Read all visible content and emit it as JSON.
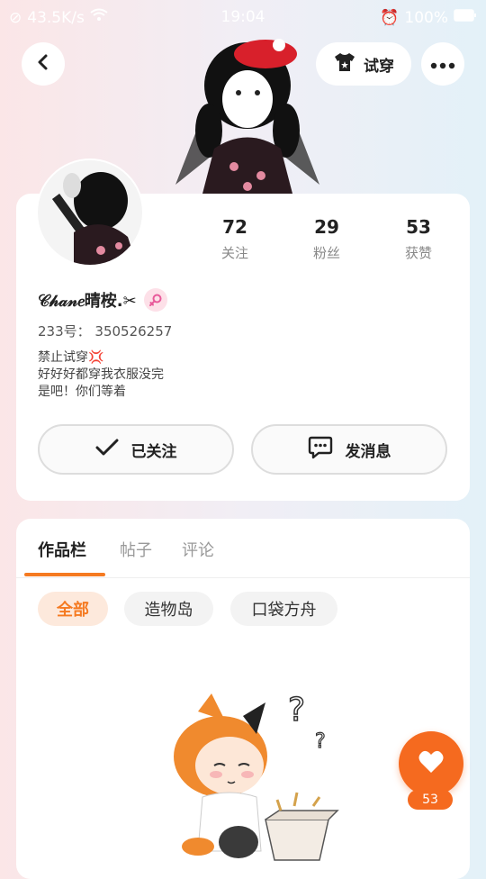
{
  "status_bar": {
    "network_speed": "43.5K/s",
    "time": "19:04",
    "battery": "100%"
  },
  "header": {
    "tryon_label": "试穿"
  },
  "profile": {
    "username": "𝒞𝒽𝒶𝓃𝑒晴桉.✂",
    "uid_label": "233号：",
    "uid": "350526257",
    "bio_lines": [
      "禁止试穿💢",
      "好好好都穿我衣服没完",
      "是吧！你们等着"
    ],
    "stats": [
      {
        "value": "72",
        "label": "关注"
      },
      {
        "value": "29",
        "label": "粉丝"
      },
      {
        "value": "53",
        "label": "获赞"
      }
    ],
    "follow_label": "已关注",
    "message_label": "发消息"
  },
  "tabs": [
    {
      "label": "作品栏",
      "active": true
    },
    {
      "label": "帖子",
      "active": false
    },
    {
      "label": "评论",
      "active": false
    }
  ],
  "filters": [
    {
      "label": "全部",
      "active": true
    },
    {
      "label": "造物岛",
      "active": false
    },
    {
      "label": "口袋方舟",
      "active": false
    }
  ],
  "like_fab": {
    "count": "53"
  },
  "colors": {
    "accent": "#f57a21",
    "chip_bg": "#fde9dc",
    "gender": "#e85a9a"
  },
  "icons": [
    "back-icon",
    "tshirt-icon",
    "more-icon",
    "check-icon",
    "chat-icon",
    "female-icon",
    "heart-icon"
  ]
}
